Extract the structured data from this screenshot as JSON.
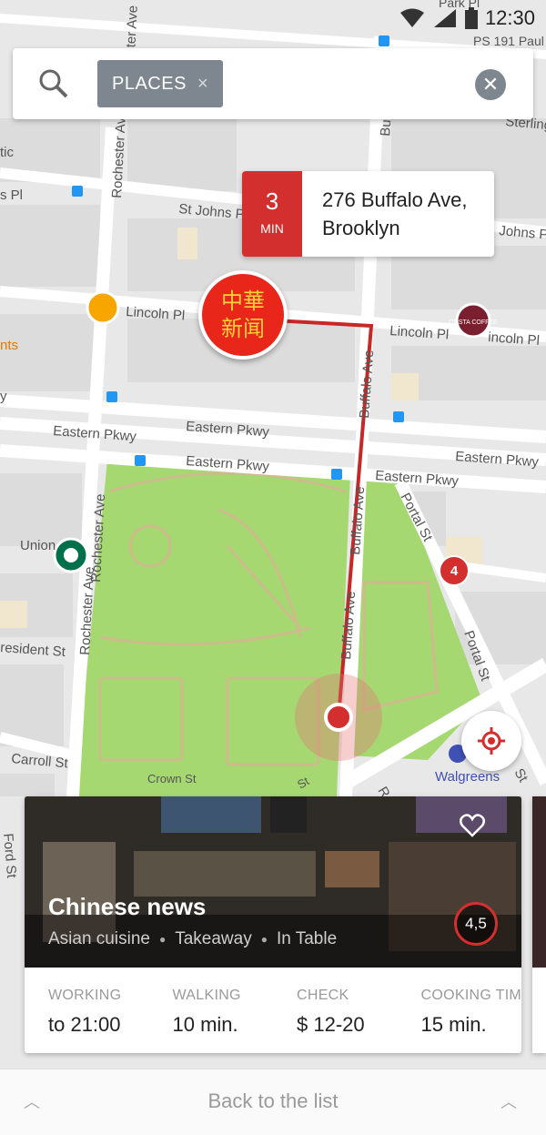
{
  "status_bar": {
    "time": "12:30"
  },
  "search": {
    "chip_label": "PLACES",
    "chip_remove": "×",
    "clear": "✕"
  },
  "route_card": {
    "minutes": "3",
    "unit": "MIN",
    "address_line1": "276 Buffalo Ave,",
    "address_line2": "Brooklyn"
  },
  "marker_logo": {
    "line1": "中華",
    "line2": "新闻"
  },
  "cluster_badge": "4",
  "map_labels": {
    "st_johns_pl": "St Johns Pl",
    "johns": "Johns P",
    "lincoln_pl": "Lincoln Pl",
    "lincoln_pl_2": "Lincoln Pl",
    "lincoln_pl_3": "incoln Pl",
    "eastern_pkwy": "Eastern Pkwy",
    "eastern_pkwy_2": "Eastern Pkwy",
    "eastern_pkwy_3": "Eastern Pkwy",
    "eastern_pkwy_4": "Eastern Pkwy",
    "eastern_pkwy_5": "Eastern Pkwy",
    "rochester_ave": "Rochester Ave",
    "rochester_ave_2": "Rochester Ave",
    "rochester_ave_3": "Rochester Ave",
    "buffalo_ave": "Buffalo Ave",
    "buffalo_ave_2": "Buffalo Ave",
    "buffalo_ave_3": "Buffalo Ave",
    "buffalo_ave_4": "Bu",
    "portal_st": "Portal St",
    "portal_st_2": "Portal St",
    "union": "Union",
    "resident_st": "resident St",
    "carroll_st": "Carroll St",
    "crown_st": "Crown St",
    "crown_st_2": "St",
    "ford_st": "Ford St",
    "ford_st_2": "Ford St",
    "walgreens": "Walgreens",
    "ps191": "PS 191 Paul",
    "park": "Park Pl",
    "pl": "s Pl",
    "tic": "tic",
    "nts": "nts",
    "sterling": "Sterling",
    "ster_ave": "ster Ave",
    "costa": "COSTA COFFEE",
    "st": "St",
    "ro": "Ro",
    "y": "y"
  },
  "place_card": {
    "name": "Chinese news",
    "tags": [
      "Asian cuisine",
      "Takeaway",
      "In Table"
    ],
    "rating": "4,5",
    "stats": [
      {
        "label": "WORKING",
        "value": "to 21:00"
      },
      {
        "label": "WALKING",
        "value": "10 min."
      },
      {
        "label": "CHECK",
        "value": "$ 12-20"
      },
      {
        "label": "COOKING TIME",
        "value": "15 min."
      }
    ]
  },
  "bottom_bar": {
    "label": "Back to the list"
  },
  "colors": {
    "accent": "#d32f2f",
    "park": "#a6d872",
    "chip": "#7e868f"
  }
}
